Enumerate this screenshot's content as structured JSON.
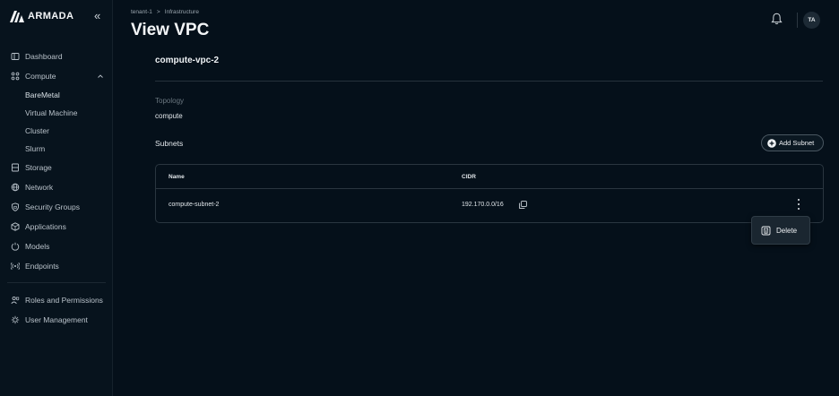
{
  "sidebar": {
    "brand": "ARMADA",
    "collapse_glyph": "«",
    "items": [
      {
        "label": "Dashboard",
        "icon": "dashboard-icon"
      },
      {
        "label": "Compute",
        "icon": "compute-icon",
        "expanded": true,
        "children": [
          "BareMetal",
          "Virtual Machine",
          "Cluster",
          "Slurm"
        ]
      },
      {
        "label": "Storage",
        "icon": "storage-icon"
      },
      {
        "label": "Network",
        "icon": "network-icon"
      },
      {
        "label": "Security Groups",
        "icon": "shield-icon"
      },
      {
        "label": "Applications",
        "icon": "cube-icon"
      },
      {
        "label": "Models",
        "icon": "model-icon"
      },
      {
        "label": "Endpoints",
        "icon": "endpoint-icon"
      }
    ],
    "bottom_items": [
      {
        "label": "Roles and Permissions",
        "icon": "roles-icon"
      },
      {
        "label": "User Management",
        "icon": "user-management-icon"
      }
    ]
  },
  "header": {
    "breadcrumb": [
      "tenant-1",
      "Infrastructure"
    ],
    "breadcrumb_sep": ">",
    "title": "View VPC",
    "avatar_initials": "TA"
  },
  "main": {
    "vpc_name": "compute-vpc-2",
    "topology_label": "Topology",
    "topology_value": "compute",
    "subnets_label": "Subnets",
    "add_subnet_label": "Add Subnet",
    "table": {
      "columns": [
        "Name",
        "CIDR"
      ],
      "rows": [
        {
          "name": "compute-subnet-2",
          "cidr": "192.170.0.0/16"
        }
      ]
    },
    "row_menu": {
      "delete_label": "Delete"
    }
  },
  "colors": {
    "background": "#05101a",
    "sidebar": "#07131d",
    "text": "#e6ebef",
    "muted": "#6b7780"
  }
}
